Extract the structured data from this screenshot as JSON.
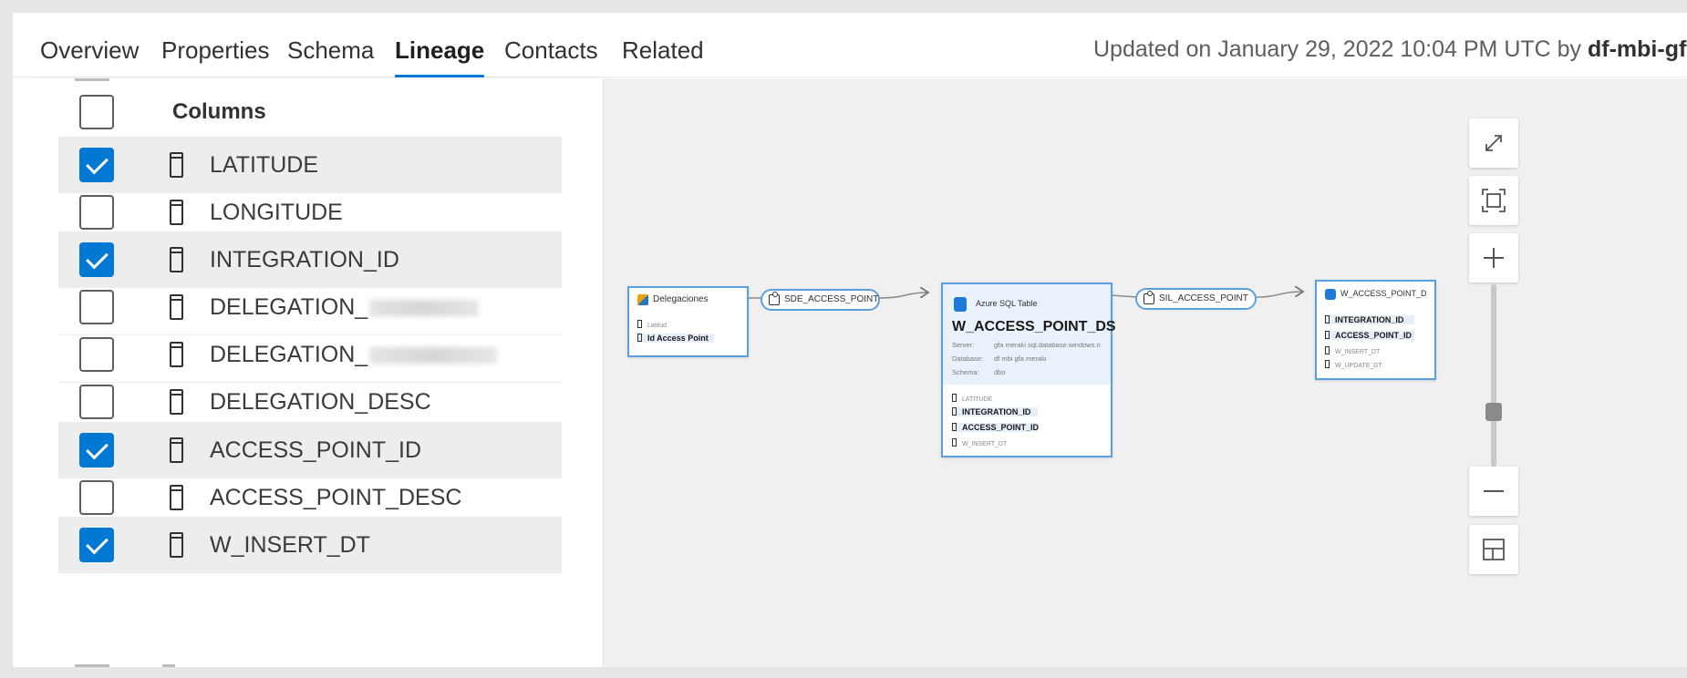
{
  "tabs": {
    "overview": "Overview",
    "properties": "Properties",
    "schema": "Schema",
    "lineage": "Lineage",
    "contacts": "Contacts",
    "related": "Related"
  },
  "updated": {
    "prefix": "Updated on January 29, 2022 10:04 PM UTC by",
    "user": "df-mbi-gfa-m"
  },
  "columns_panel": {
    "header": "Columns",
    "rows": [
      {
        "label": "LATITUDE",
        "checked": true
      },
      {
        "label": "LONGITUDE",
        "checked": false
      },
      {
        "label": "INTEGRATION_ID",
        "checked": true
      },
      {
        "label": "DELEGATION_",
        "checked": false,
        "redacted": true
      },
      {
        "label": "DELEGATION_",
        "checked": false,
        "redacted": true
      },
      {
        "label": "DELEGATION_DESC",
        "checked": false
      },
      {
        "label": "ACCESS_POINT_ID",
        "checked": true
      },
      {
        "label": "ACCESS_POINT_DESC",
        "checked": false
      },
      {
        "label": "W_INSERT_DT",
        "checked": true
      }
    ]
  },
  "lineage": {
    "source": {
      "title": "Delegaciones",
      "items": [
        "Latitud",
        "Id Access Point"
      ]
    },
    "process1": "SDE_ACCESS_POINT",
    "center": {
      "type": "Azure SQL Table",
      "title": "W_ACCESS_POINT_DS",
      "server_label": "Server:",
      "server_value": "gfa meraki sql.database.windows.n",
      "database_label": "Database:",
      "database_value": "df mbi gfa meraki",
      "schema_label": "Schema:",
      "schema_value": "dbo",
      "items": [
        "LATITUDE",
        "INTEGRATION_ID",
        "ACCESS_POINT_ID",
        "W_INSERT_DT"
      ]
    },
    "process2": "SIL_ACCESS_POINT",
    "target": {
      "title": "W_ACCESS_POINT_D",
      "items": [
        "INTEGRATION_ID",
        "ACCESS_POINT_ID",
        "W_INSERT_DT",
        "W_UPDATE_DT"
      ]
    }
  },
  "colors": {
    "accent": "#0078d4",
    "node_border": "#5aa0e0",
    "selected_row": "#ededed",
    "canvas_bg": "#f0f0f0"
  },
  "icons": [
    "expand-icon",
    "fit-to-screen-icon",
    "zoom-in-icon",
    "zoom-out-icon",
    "minimap-icon",
    "column-icon",
    "checkbox-icon",
    "process-icon",
    "sql-table-icon"
  ]
}
